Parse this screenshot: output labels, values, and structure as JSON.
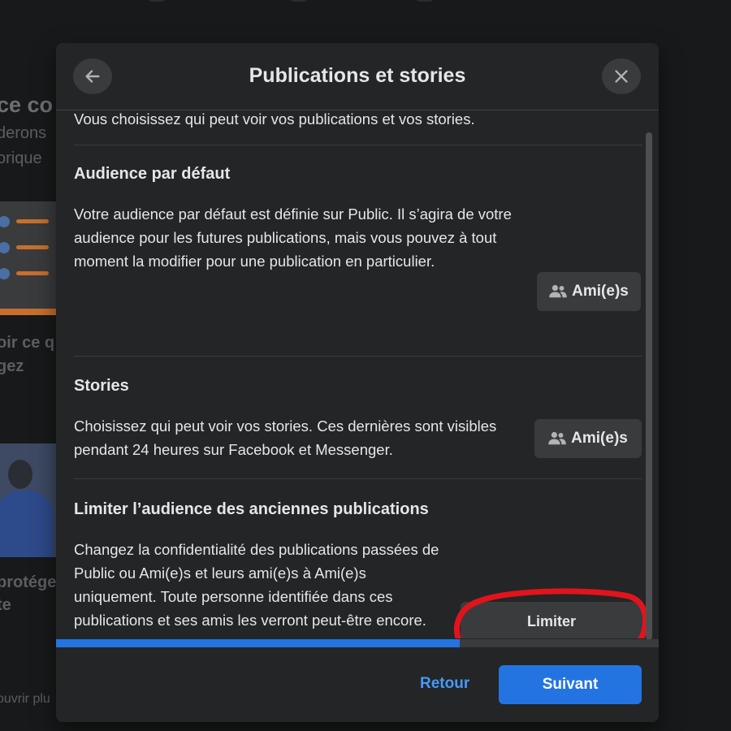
{
  "background": {
    "heading": "ce co",
    "line1": "derons",
    "line2": "orique",
    "caption1a": "oir ce q",
    "caption1b": "gez",
    "caption2a": "protége",
    "caption2b": "te",
    "caption3": "ouvrir plu"
  },
  "dialog": {
    "title": "Publications et stories",
    "back_icon": "arrow-left-icon",
    "close_icon": "close-icon",
    "intro": "Vous choisissez qui peut voir vos publications et vos stories.",
    "sections": [
      {
        "title": "Audience par défaut",
        "description": "Votre audience par défaut est définie sur Public. Il s’agira de votre audience pour les futures publications, mais vous pouvez à tout moment la modifier pour une publication en particulier.",
        "button_label": "Ami(e)s",
        "button_icon": "friends-icon"
      },
      {
        "title": "Stories",
        "description": "Choisissez qui peut voir vos stories. Ces dernières sont visibles pendant 24 heures sur Facebook et Messenger.",
        "button_label": "Ami(e)s",
        "button_icon": "friends-icon"
      },
      {
        "title": "Limiter l’audience des anciennes publications",
        "description": "Changez la confidentialité des publications passées de Public ou Ami(e)s et leurs ami(e)s à Ami(e)s uniquement. Toute personne identifiée dans ces publications et ses amis les verront peut-être encore.",
        "button_label": "Limiter"
      }
    ],
    "progress_fraction": 0.67,
    "footer": {
      "back_label": "Retour",
      "next_label": "Suivant"
    }
  },
  "colors": {
    "accent": "#2374e1",
    "link": "#4599ff",
    "highlight_annotation": "#e0141c",
    "modal_bg": "#242526",
    "button_bg": "#3a3b3c"
  }
}
